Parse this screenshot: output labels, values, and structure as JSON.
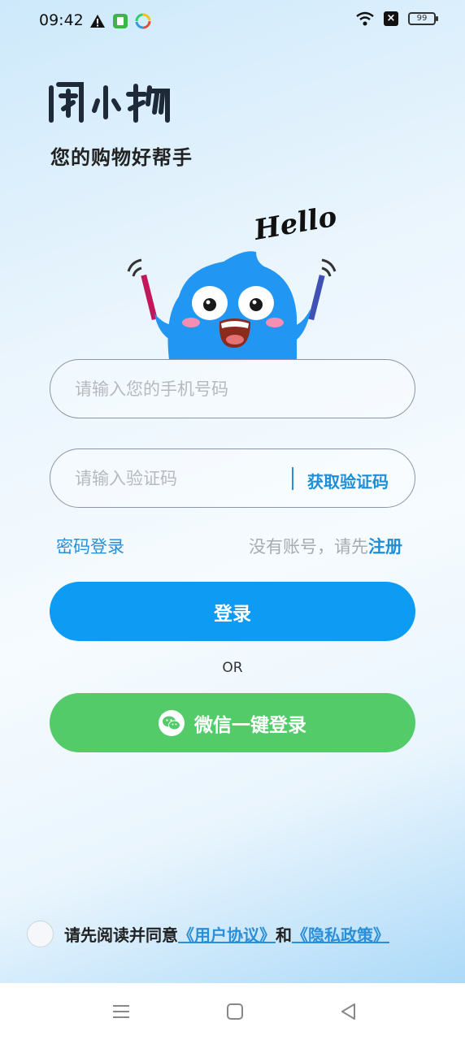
{
  "status_bar": {
    "time": "09:42",
    "battery": "99",
    "icons": [
      "alert-icon",
      "app-icon",
      "pinwheel-icon",
      "wifi-icon",
      "close-box-icon",
      "battery-icon"
    ]
  },
  "brand": {
    "logo_text": "闲小物",
    "slogan": "您的购物好帮手"
  },
  "mascot": {
    "caption": "Hello"
  },
  "form": {
    "phone_placeholder": "请输入您的手机号码",
    "code_placeholder": "请输入验证码",
    "get_code_label": "获取验证码"
  },
  "links": {
    "password_login": "密码登录",
    "register_hint": "没有账号，请先",
    "register": "注册"
  },
  "buttons": {
    "login": "登录",
    "or": "OR",
    "wechat_login": "微信一键登录"
  },
  "agreement": {
    "prefix": "请先阅读并同意",
    "user_agreement": "《用户协议》",
    "and": "和",
    "privacy_policy": "《隐私政策》"
  },
  "colors": {
    "primary": "#0d9bf4",
    "wechat": "#52cb68",
    "link": "#2a8fd6"
  }
}
